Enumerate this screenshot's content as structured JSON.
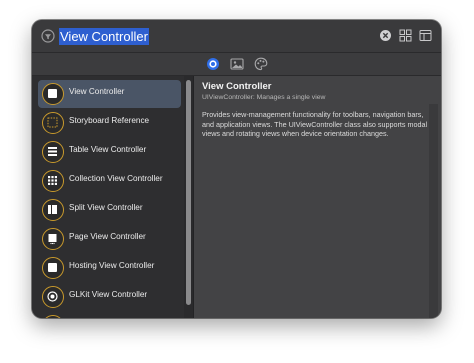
{
  "search": {
    "value": "View Controller"
  },
  "colors": {
    "selection": "#2e5fd0",
    "accent": "#2f6ee8",
    "icon_ring": "#c99a2c",
    "selected_row": "#4a5566"
  },
  "toolbar_icons": [
    "filter-icon",
    "clear-search-icon",
    "grid-view-icon",
    "detail-view-icon"
  ],
  "tabs": [
    {
      "icon": "objects-tab-icon",
      "selected": true
    },
    {
      "icon": "media-tab-icon",
      "selected": false
    },
    {
      "icon": "colors-tab-icon",
      "selected": false
    }
  ],
  "library": {
    "items": [
      {
        "label": "View Controller",
        "icon": "view-controller-icon",
        "selected": true
      },
      {
        "label": "Storyboard Reference",
        "icon": "storyboard-reference-icon",
        "selected": false
      },
      {
        "label": "Table View Controller",
        "icon": "table-view-controller-icon",
        "selected": false
      },
      {
        "label": "Collection View Controller",
        "icon": "collection-view-controller-icon",
        "selected": false
      },
      {
        "label": "Split View Controller",
        "icon": "split-view-controller-icon",
        "selected": false
      },
      {
        "label": "Page View Controller",
        "icon": "page-view-controller-icon",
        "selected": false
      },
      {
        "label": "Hosting View Controller",
        "icon": "hosting-view-controller-icon",
        "selected": false
      },
      {
        "label": "GLKit View Controller",
        "icon": "glkit-view-controller-icon",
        "selected": false
      }
    ]
  },
  "detail": {
    "title": "View Controller",
    "subtitle": "UIViewController: Manages a single view",
    "description": "Provides view-management functionality for toolbars, navigation bars, and application views. The UIViewController class also supports modal views and rotating views when device orientation changes."
  }
}
